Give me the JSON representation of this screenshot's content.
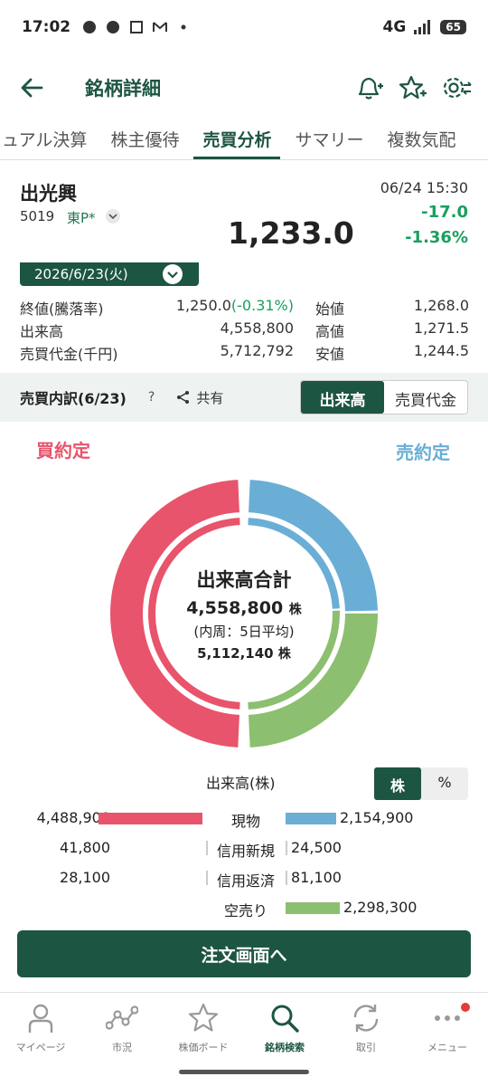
{
  "status": {
    "time": "17:02",
    "network": "4G",
    "battery": "65"
  },
  "appbar": {
    "title": "銘柄詳細"
  },
  "tabs": [
    "ュアル決算",
    "株主優待",
    "売買分析",
    "サマリー",
    "複数気配"
  ],
  "stock": {
    "name": "出光興",
    "code": "5019",
    "market": "東P*",
    "price": "1,233.0",
    "datetime": "06/24 15:30",
    "change": "-17.0",
    "change_pct": "-1.36%",
    "selected_date": "2026/6/23(火)"
  },
  "quote": {
    "close_label": "終値(騰落率)",
    "close_value": "1,250.0",
    "close_pct": "(-0.31%)",
    "volume_label": "出来高",
    "volume_value": "4,558,800",
    "turnover_label": "売買代金(千円)",
    "turnover_value": "5,712,792",
    "open_label": "始値",
    "open_value": "1,268.0",
    "high_label": "高値",
    "high_value": "1,271.5",
    "low_label": "安値",
    "low_value": "1,244.5"
  },
  "breakdown": {
    "title": "売買内訳(6/23)",
    "help": "?",
    "share_label": "共有",
    "seg_volume": "出来高",
    "seg_value": "売買代金"
  },
  "donut": {
    "buy_label": "買約定",
    "sell_label": "売約定",
    "center_title": "出来高合計",
    "total": "4,558,800",
    "unit": "株",
    "sub_label": "(内周：5日平均)",
    "avg": "5,112,140",
    "buy_color": "#e8546b",
    "sell_cash_color": "#6aaed6",
    "sell_short_color": "#8cbf6f"
  },
  "volume_table": {
    "label": "出来高(株)",
    "unit_share": "株",
    "unit_pct": "%",
    "rows": [
      {
        "category": "現物",
        "buy": "4,488,900",
        "sell": "2,154,900"
      },
      {
        "category": "信用新規",
        "buy": "41,800",
        "sell": "24,500"
      },
      {
        "category": "信用返済",
        "buy": "28,100",
        "sell": "81,100"
      },
      {
        "category": "空売り",
        "buy": "",
        "sell": "2,298,300"
      }
    ]
  },
  "order_button": "注文画面へ",
  "nav": [
    {
      "label": "マイページ",
      "icon": "person-icon"
    },
    {
      "label": "市況",
      "icon": "market-icon"
    },
    {
      "label": "株価ボード",
      "icon": "star-icon"
    },
    {
      "label": "銘柄検索",
      "icon": "search-icon"
    },
    {
      "label": "取引",
      "icon": "trade-icon"
    },
    {
      "label": "メニュー",
      "icon": "menu-icon"
    }
  ]
}
